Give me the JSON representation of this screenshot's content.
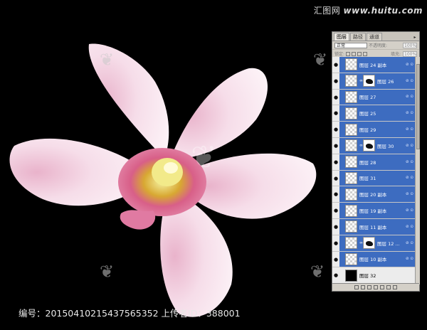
{
  "watermark": {
    "site_cn": "汇图网",
    "site_url": "www.huitu.com"
  },
  "caption": "编号：20150410215437565352 上传者ID：388001",
  "panel": {
    "tabs": [
      "图层",
      "路径",
      "通道"
    ],
    "blend_mode": "正常",
    "opacity_label": "不透明度:",
    "opacity_value": "100%",
    "lock_label": "锁定:",
    "fill_label": "填充:",
    "fill_value": "100%",
    "layers": [
      {
        "name": "图层 24 副本",
        "type": "normal",
        "fx": true
      },
      {
        "name": "图层 26",
        "type": "mask",
        "fx": true
      },
      {
        "name": "图层 27",
        "type": "normal",
        "fx": true
      },
      {
        "name": "图层 25",
        "type": "normal",
        "fx": true
      },
      {
        "name": "图层 29",
        "type": "normal",
        "fx": true
      },
      {
        "name": "图层 30",
        "type": "mask",
        "fx": true
      },
      {
        "name": "图层 28",
        "type": "normal",
        "fx": true
      },
      {
        "name": "图层 31",
        "type": "normal",
        "fx": true
      },
      {
        "name": "图层 20 副本",
        "type": "normal",
        "fx": true
      },
      {
        "name": "图层 19 副本",
        "type": "normal",
        "fx": true
      },
      {
        "name": "图层 11 副本",
        "type": "normal",
        "fx": true
      },
      {
        "name": "图层 12 ...",
        "type": "mask",
        "fx": true
      },
      {
        "name": "图层 10 副本",
        "type": "normal",
        "fx": true
      },
      {
        "name": "图层 32",
        "type": "black",
        "fx": false
      }
    ]
  },
  "colors": {
    "background": "#000000",
    "selected_layer": "#3d6cc0",
    "petal_light": "#fbeef4",
    "petal_pink": "#e8a9c6",
    "center": "#d2567f"
  }
}
